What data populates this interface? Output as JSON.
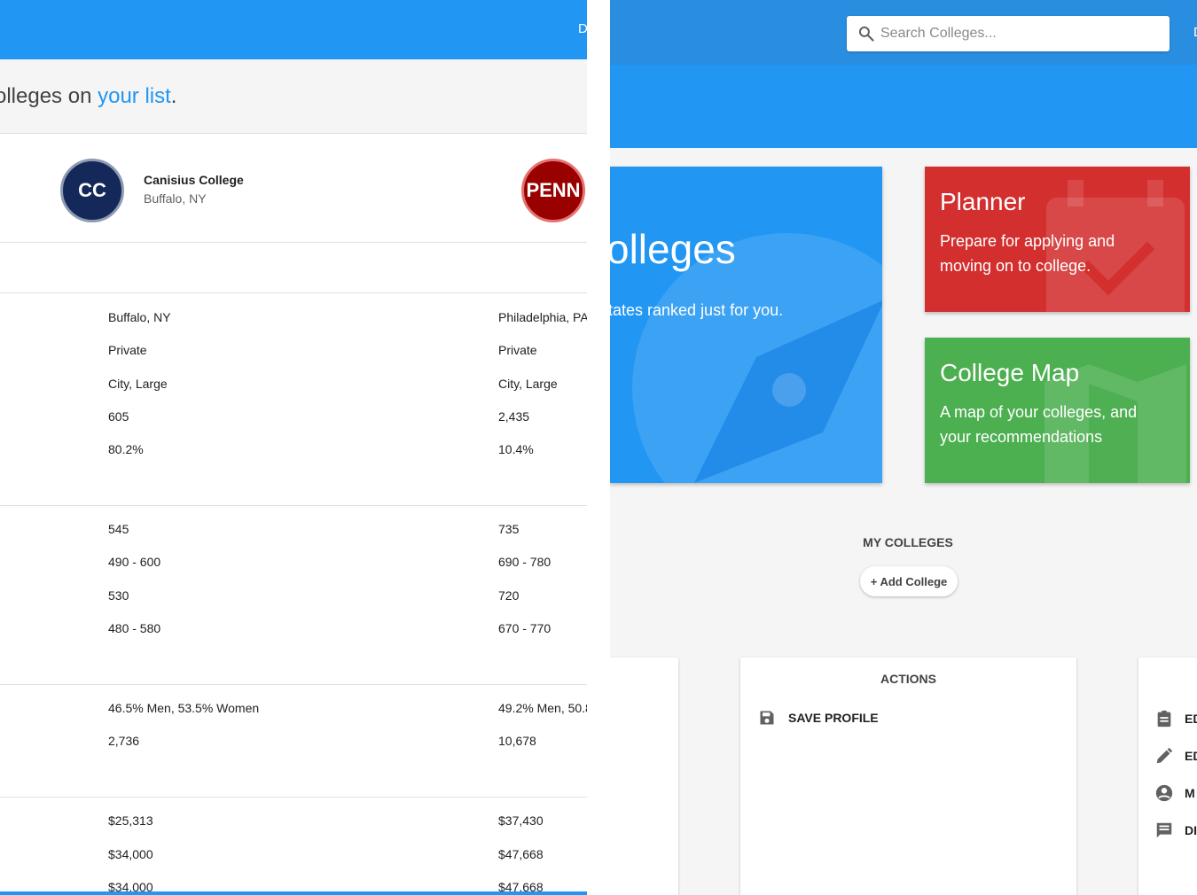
{
  "left": {
    "topbar_cut": "D",
    "banner": {
      "prefix": "olleges on ",
      "link": "your list",
      "suffix": "."
    },
    "colleges": [
      {
        "logo": "CC",
        "name": "Canisius College",
        "location": "Buffalo, NY"
      },
      {
        "logo": "PENN"
      }
    ],
    "sections": [
      {
        "rows": [
          [
            "Buffalo, NY",
            "Philadelphia, PA"
          ],
          [
            "Private",
            "Private"
          ],
          [
            "City, Large",
            "City, Large"
          ],
          [
            "605",
            "2,435"
          ],
          [
            "80.2%",
            "10.4%"
          ]
        ]
      },
      {
        "rows": [
          [
            "545",
            "735"
          ],
          [
            "490 - 600",
            "690 - 780"
          ],
          [
            "530",
            "720"
          ],
          [
            "480 - 580",
            "670 - 770"
          ]
        ]
      },
      {
        "rows": [
          [
            "46.5% Men, 53.5% Women",
            "49.2% Men, 50.8"
          ],
          [
            "2,736",
            "10,678"
          ]
        ]
      },
      {
        "rows": [
          [
            "$25,313",
            "$37,430"
          ],
          [
            "$34,000",
            "$47,668"
          ],
          [
            "$34,000",
            "$47,668"
          ]
        ]
      }
    ]
  },
  "right": {
    "topbar_cut": "D",
    "search": {
      "placeholder": "Search Colleges...",
      "value": ""
    },
    "tiles": {
      "colleges": {
        "title": "olleges",
        "subtitle": "tates ranked just for you."
      },
      "planner": {
        "title": "Planner",
        "subtitle": "Prepare for applying and moving on to college."
      },
      "map": {
        "title": "College Map",
        "subtitle": "A map of your colleges, and your recommendations"
      }
    },
    "my_colleges_label": "MY COLLEGES",
    "add_college_label": "+ Add College",
    "actions": {
      "title": "ACTIONS",
      "save_profile": "SAVE PROFILE"
    },
    "right_menu": [
      "ED",
      "ED",
      "M",
      "DI"
    ]
  },
  "colors": {
    "primary": "#2196f3",
    "planner": "#d32f2f",
    "map": "#4caf50",
    "cc_logo": "#14295a",
    "penn_logo": "#990000"
  },
  "icons": [
    "search-icon",
    "compass-icon",
    "calendar-check-icon",
    "map-icon",
    "save-icon",
    "clipboard-icon",
    "pencil-icon",
    "account-circle-icon",
    "message-icon"
  ]
}
